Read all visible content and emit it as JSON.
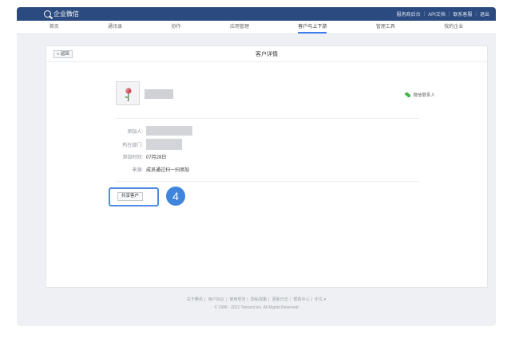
{
  "app": {
    "brand": "企业微信",
    "top_links": [
      "服务商后台",
      "API文档",
      "联系客服",
      "退出"
    ]
  },
  "nav": {
    "items": [
      "首页",
      "通讯录",
      "协作",
      "应用管理",
      "客户与上下游",
      "管理工具",
      "我的企业"
    ],
    "active_index": 4
  },
  "panel": {
    "back_label": "« 返回",
    "title": "客户详情",
    "wechat_tag": "微信联系人"
  },
  "info": {
    "added_by_label": "添加人:",
    "department_label": "所在部门:",
    "added_time_label": "添加时间:",
    "added_time_value": "07月28日",
    "source_label": "来源:",
    "source_value": "成员通过扫一扫添加"
  },
  "actions": {
    "share_label": "共享客户",
    "step_number": "4"
  },
  "footer": {
    "links": [
      "关于腾讯",
      "用户协议",
      "使用规范",
      "隐私政策",
      "更新日志",
      "帮助中心",
      "中文 ▾"
    ],
    "copyright": "© 1998 - 2022 Tencent Inc. All Rights Reserved"
  },
  "colors": {
    "topbar": "#2b4a7f",
    "accent": "#3f85de",
    "wechat_green": "#3fb54a"
  }
}
